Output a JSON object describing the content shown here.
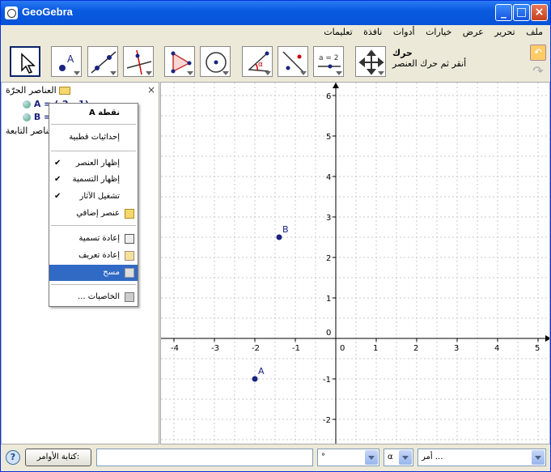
{
  "window": {
    "title": "GeoGebra"
  },
  "menubar": [
    "ملف",
    "تحرير",
    "عرض",
    "خيارات",
    "أدوات",
    "نافذة",
    "تعليمات"
  ],
  "toolbar": {
    "hint_title": "حرك",
    "hint_text": "أنقر ثم حرك العنصر",
    "slider_label": "a = 2",
    "tools": [
      "move-tool",
      "point-tool",
      "line-tool",
      "perpendicular-tool",
      "polygon-tool",
      "circle-tool",
      "angle-tool",
      "reflect-tool",
      "slider-tool",
      "move-view-tool"
    ]
  },
  "algebra": {
    "free_objects": "العناصر الحرّة",
    "dependent_objects": "العناصر التابعة",
    "point_a": "A = (-2, -1)",
    "point_b": "B = (-1.4, 2.5)",
    "close": "×"
  },
  "context_menu": {
    "header": "نقطة A",
    "items": [
      {
        "label": "إحداثيات قطبية",
        "checked": false
      },
      {
        "label": "إظهار العنصر",
        "checked": true
      },
      {
        "label": "إظهار التسمية",
        "checked": true
      },
      {
        "label": "تشغيل الآثار",
        "checked": true
      },
      {
        "label": "عنصر إضافي",
        "checked": false
      },
      {
        "label": "إعادة تسمية",
        "checked": false
      },
      {
        "label": "إعادة تعريف",
        "checked": false
      },
      {
        "label": "مسح",
        "checked": false,
        "selected": true
      },
      {
        "label": "الخاصيات ...",
        "checked": false
      }
    ],
    "check_mark": "✔"
  },
  "graph": {
    "x_ticks": [
      "-4",
      "-3",
      "-2",
      "-1",
      "0",
      "1",
      "2",
      "3",
      "4",
      "5"
    ],
    "y_ticks": [
      "6",
      "5",
      "4",
      "3",
      "2",
      "1",
      "0",
      "-1",
      "-2"
    ],
    "points": [
      {
        "name": "A",
        "x": -2,
        "y": -1
      },
      {
        "name": "B",
        "x": -1.4,
        "y": 2.5
      }
    ],
    "point_color": "#1a237e"
  },
  "statusbar": {
    "command_button": "كتابة الأوامر:",
    "symbol_combo": "°",
    "greek_combo": "α",
    "command_combo": "أمر ..."
  }
}
